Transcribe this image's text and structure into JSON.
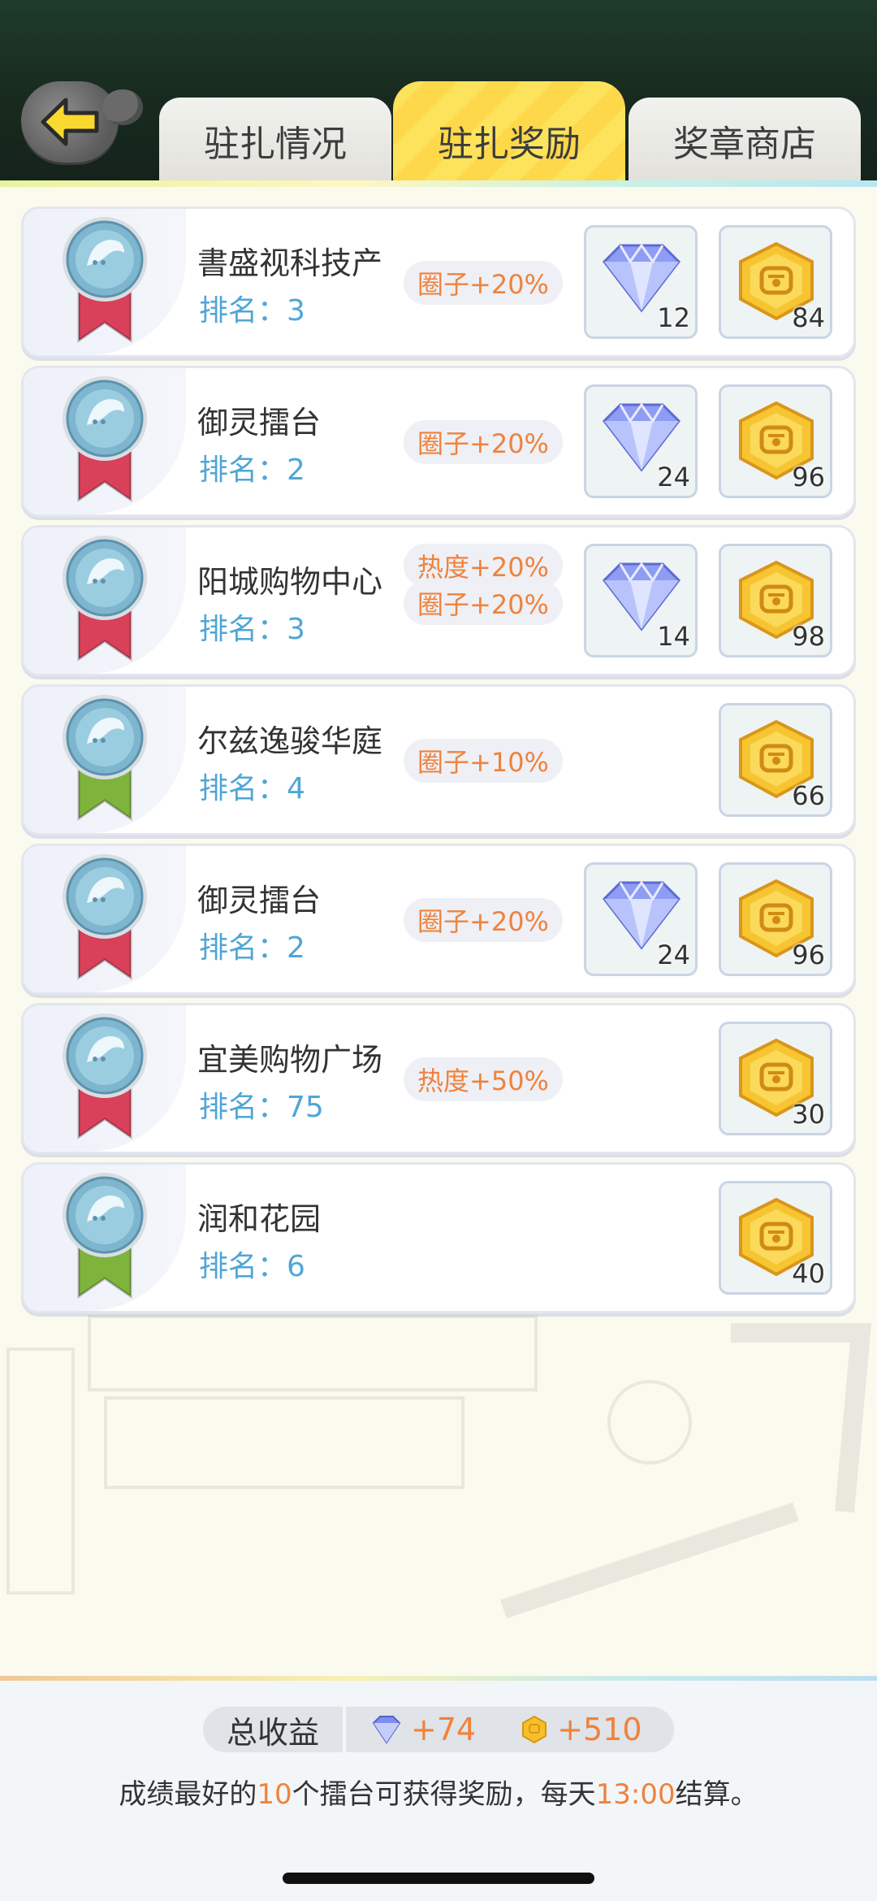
{
  "header": {
    "tabs": [
      {
        "label": "驻扎情况",
        "active": false
      },
      {
        "label": "驻扎奖励",
        "active": true
      },
      {
        "label": "奖章商店",
        "active": false
      }
    ],
    "back_icon": "arrow-left-icon"
  },
  "rank_prefix": "排名：",
  "cards": [
    {
      "title": "書盛视科技产",
      "rank": "3",
      "ribbon": "red",
      "bonuses": [
        "圈子+20%"
      ],
      "gem": "12",
      "coin": "84"
    },
    {
      "title": "御灵擂台",
      "rank": "2",
      "ribbon": "red",
      "bonuses": [
        "圈子+20%"
      ],
      "gem": "24",
      "coin": "96"
    },
    {
      "title": "阳城购物中心",
      "rank": "3",
      "ribbon": "red",
      "bonuses": [
        "热度+20%",
        "圈子+20%"
      ],
      "gem": "14",
      "coin": "98"
    },
    {
      "title": "尔兹逸骏华庭",
      "rank": "4",
      "ribbon": "green",
      "bonuses": [
        "圈子+10%"
      ],
      "gem": null,
      "coin": "66"
    },
    {
      "title": "御灵擂台",
      "rank": "2",
      "ribbon": "red",
      "bonuses": [
        "圈子+20%"
      ],
      "gem": "24",
      "coin": "96"
    },
    {
      "title": "宜美购物广场",
      "rank": "75",
      "ribbon": "red",
      "bonuses": [
        "热度+50%"
      ],
      "gem": null,
      "coin": "30"
    },
    {
      "title": "润和花园",
      "rank": "6",
      "ribbon": "green",
      "bonuses": [],
      "gem": null,
      "coin": "40"
    }
  ],
  "footer": {
    "total_label": "总收益",
    "gem_total": "+74",
    "coin_total": "+510",
    "notice_parts": [
      "成绩最好的",
      "10",
      "个擂台可获得奖励，每天",
      "13:00",
      "结算。"
    ]
  },
  "colors": {
    "accent": "#f0823c",
    "rank": "#4fa6d6",
    "ribbon_red": "#d9405a",
    "ribbon_green": "#7fb43c",
    "tab_active": "#fde35c"
  }
}
